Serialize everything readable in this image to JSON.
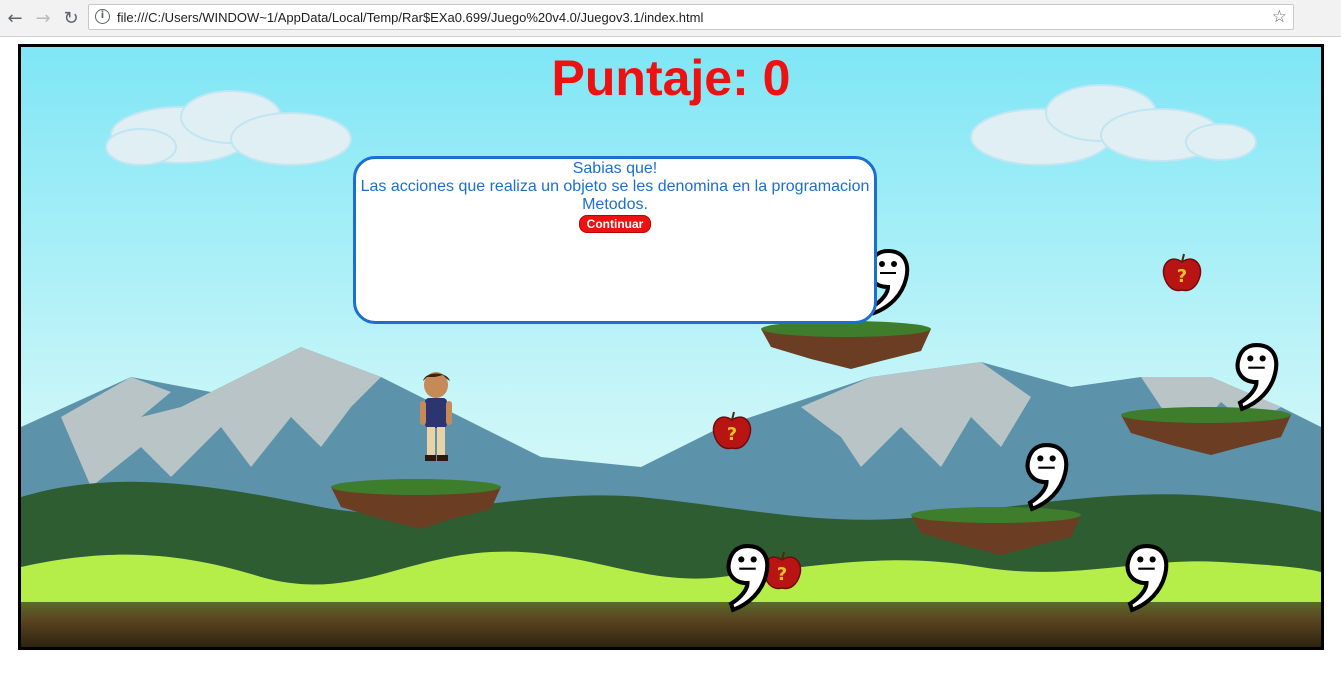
{
  "browser": {
    "url": "file:///C:/Users/WINDOW~1/AppData/Local/Temp/Rar$EXa0.699/Juego%20v4.0/Juegov3.1/index.html",
    "back_icon": "back-arrow-icon",
    "forward_icon": "forward-arrow-icon",
    "reload_icon": "reload-icon",
    "info_icon": "info-icon",
    "bookmark_icon": "star-icon"
  },
  "game": {
    "score_label": "Puntaje: 0",
    "dialog": {
      "title": "Sabias que!",
      "message": "Las acciones que realiza un objeto se les denomina en la programacion",
      "answer": "Metodos.",
      "continue_label": "Continuar"
    },
    "colors": {
      "score": "#ee1111",
      "dialog_border": "#1a6fcf",
      "dialog_text": "#1a6fcf",
      "button": "#ee1111"
    }
  }
}
